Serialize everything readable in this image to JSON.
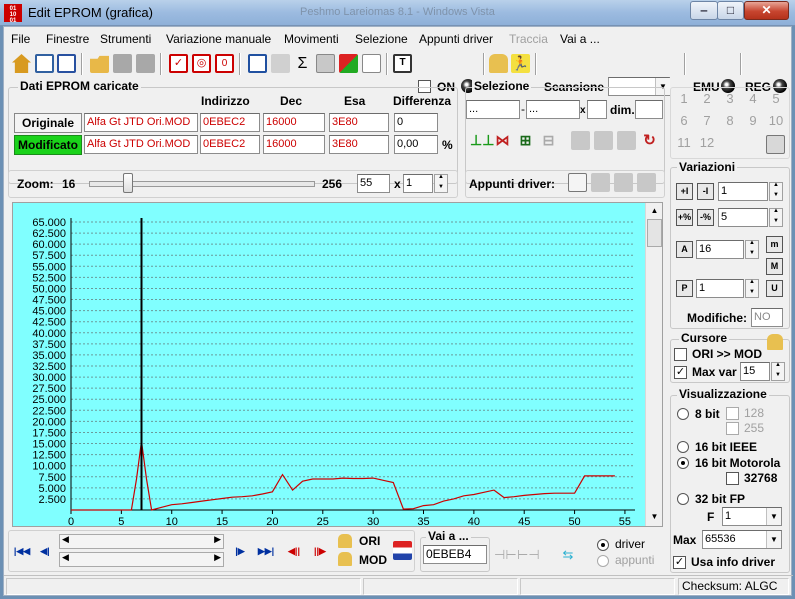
{
  "window": {
    "title": "Edit EPROM (grafica)",
    "ghost_title": "Peshmo   Lareiomas 8.1 - Windows Vista"
  },
  "menu": [
    "File",
    "Finestre",
    "Strumenti",
    "Variazione manuale",
    "Movimenti",
    "Selezione",
    "Appunti driver",
    "Traccia",
    "Vai a ..."
  ],
  "menu_disabled": [
    "Traccia"
  ],
  "toolbar": {
    "on_label": "ON",
    "scansione_label": "Scansione",
    "scansione_value": "",
    "emu_label": "EMU",
    "reg_label": "REG"
  },
  "dati": {
    "title": "Dati EPROM caricate",
    "headers": {
      "indirizzo": "Indirizzo",
      "dec": "Dec",
      "esa": "Esa",
      "differenza": "Differenza"
    },
    "originale": {
      "label": "Originale",
      "file": "Alfa Gt JTD Ori.MOD",
      "indirizzo": "0EBEC2",
      "dec": "16000",
      "esa": "3E80",
      "diff": "0"
    },
    "modificato": {
      "label": "Modificato",
      "file": "Alfa Gt JTD Ori.MOD",
      "indirizzo": "0EBEC2",
      "dec": "16000",
      "esa": "3E80",
      "diff": "0,00",
      "pct": "%"
    }
  },
  "selezione": {
    "title": "Selezione",
    "from": "...",
    "to": "...",
    "x": "x",
    "dim_label": "dim."
  },
  "numpad": [
    "1",
    "2",
    "3",
    "4",
    "5",
    "6",
    "7",
    "8",
    "9",
    "10",
    "11",
    "12"
  ],
  "zoom": {
    "label": "Zoom:",
    "min": "16",
    "max": "256",
    "value": "55",
    "x_label": "x",
    "mult": "1"
  },
  "appunti": {
    "label": "Appunti driver:"
  },
  "variazioni": {
    "title": "Variazioni",
    "v1": "1",
    "v2": "5",
    "v3": "16",
    "v4": "1",
    "modifiche_label": "Modifiche:",
    "modifiche_value": "NO"
  },
  "cursore": {
    "title": "Cursore",
    "ori_mod": "ORI >> MOD",
    "max_var_label": "Max var",
    "max_var_value": "15",
    "max_var_checked": "✓",
    "ori_mod_checked": ""
  },
  "visualizzazione": {
    "title": "Visualizzazione",
    "bit8": "8 bit",
    "v128": "128",
    "v255": "255",
    "ieee": "16 bit IEEE",
    "motorola": "16 bit Motorola",
    "v32768": "32768",
    "fp32": "32 bit FP",
    "f_label": "F",
    "f_value": "1",
    "max_label": "Max",
    "max_value": "65536",
    "usa_info": "Usa info driver",
    "usa_info_checked": "✓"
  },
  "nav": {
    "ori": "ORI",
    "mod": "MOD"
  },
  "vai_a": {
    "title": "Vai a ...",
    "value": "0EBEB4",
    "driver": "driver",
    "appunti": "appunti"
  },
  "status": {
    "checksum": "Checksum: ALGC"
  },
  "chart_data": {
    "type": "line",
    "x": [
      0,
      1,
      2,
      3,
      4,
      5,
      6,
      6.5,
      7,
      7.5,
      8,
      9,
      10,
      11,
      12,
      13,
      14,
      15,
      16,
      17,
      18,
      19,
      20,
      21,
      22,
      23,
      24,
      25,
      26,
      27,
      28,
      29,
      30,
      31,
      32,
      33,
      34,
      35,
      36,
      37,
      38,
      39,
      40,
      41,
      42,
      43,
      44,
      45,
      46,
      47,
      48,
      49,
      50,
      51,
      52,
      53,
      54
    ],
    "y": [
      0,
      0,
      0,
      0,
      0,
      0,
      0,
      7000,
      15500,
      7000,
      0,
      600,
      1200,
      1400,
      1700,
      2000,
      2300,
      2600,
      2900,
      3000,
      3200,
      3600,
      4100,
      8000,
      4500,
      6500,
      7000,
      7000,
      7000,
      7200,
      7100,
      7100,
      7200,
      6700,
      6200,
      200,
      300,
      1000,
      1200,
      2000,
      2500,
      3200,
      3500,
      4000,
      4500,
      2800,
      3000,
      3300,
      3500,
      3700,
      3800,
      3800,
      3800,
      7700,
      7700,
      7700,
      7700
    ],
    "cursor_x": 7,
    "xlim": [
      0,
      56
    ],
    "ylim": [
      0,
      65000
    ],
    "xticks": [
      0,
      5,
      10,
      15,
      20,
      25,
      30,
      35,
      40,
      45,
      50,
      55
    ],
    "yticks": [
      0,
      2500,
      5000,
      7500,
      10000,
      12500,
      15000,
      17500,
      20000,
      22500,
      25000,
      27500,
      30000,
      32500,
      35000,
      37500,
      40000,
      42500,
      45000,
      47500,
      50000,
      52500,
      55000,
      57500,
      60000,
      62500,
      65000
    ],
    "ytick_labels": [
      "0",
      "2.500",
      "5.000",
      "7.500",
      "10.000",
      "12.500",
      "15.000",
      "17.500",
      "20.000",
      "22.500",
      "25.000",
      "27.500",
      "30.000",
      "32.500",
      "35.000",
      "37.500",
      "40.000",
      "42.500",
      "45.000",
      "47.500",
      "50.000",
      "52.500",
      "55.000",
      "57.500",
      "60.000",
      "62.500",
      "65.000"
    ],
    "grid": true,
    "background": "#80ffff",
    "line_color": "#cc0000",
    "cursor_color": "#000000"
  }
}
